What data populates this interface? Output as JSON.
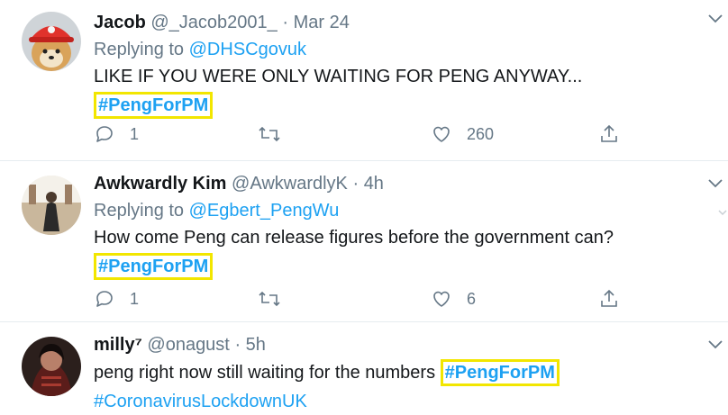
{
  "tweets": [
    {
      "name": "Jacob",
      "handle": "@_Jacob2001_",
      "separator": "·",
      "time": "Mar 24",
      "replying_prefix": "Replying to ",
      "replying_to": "@DHSCgovuk",
      "text": "LIKE IF YOU WERE ONLY WAITING FOR PENG ANYWAY...",
      "hashtag": "#PengForPM",
      "replies": "1",
      "retweets": "",
      "likes": "260",
      "avatar_icon": "shiba-dog-red-hat-avatar"
    },
    {
      "name": "Awkwardly Kim",
      "handle": "@AwkwardlyK",
      "separator": "·",
      "time": "4h",
      "replying_prefix": "Replying to ",
      "replying_to": "@Egbert_PengWu",
      "text": "How come Peng can release figures before the government can?",
      "hashtag": "#PengForPM",
      "replies": "1",
      "retweets": "",
      "likes": "6",
      "avatar_icon": "person-photo-avatar"
    },
    {
      "name": "milly⁷",
      "handle": "@onagust",
      "separator": "·",
      "time": "5h",
      "text": "peng right now still waiting for the numbers",
      "hashtag": "#PengForPM",
      "hashtag2": "#CoronavirusLockdownUK",
      "avatar_icon": "person-dark-photo-avatar"
    }
  ],
  "colors": {
    "link": "#1da1f2",
    "muted": "#657786",
    "highlight": "#f2e600",
    "text": "#14171a"
  }
}
